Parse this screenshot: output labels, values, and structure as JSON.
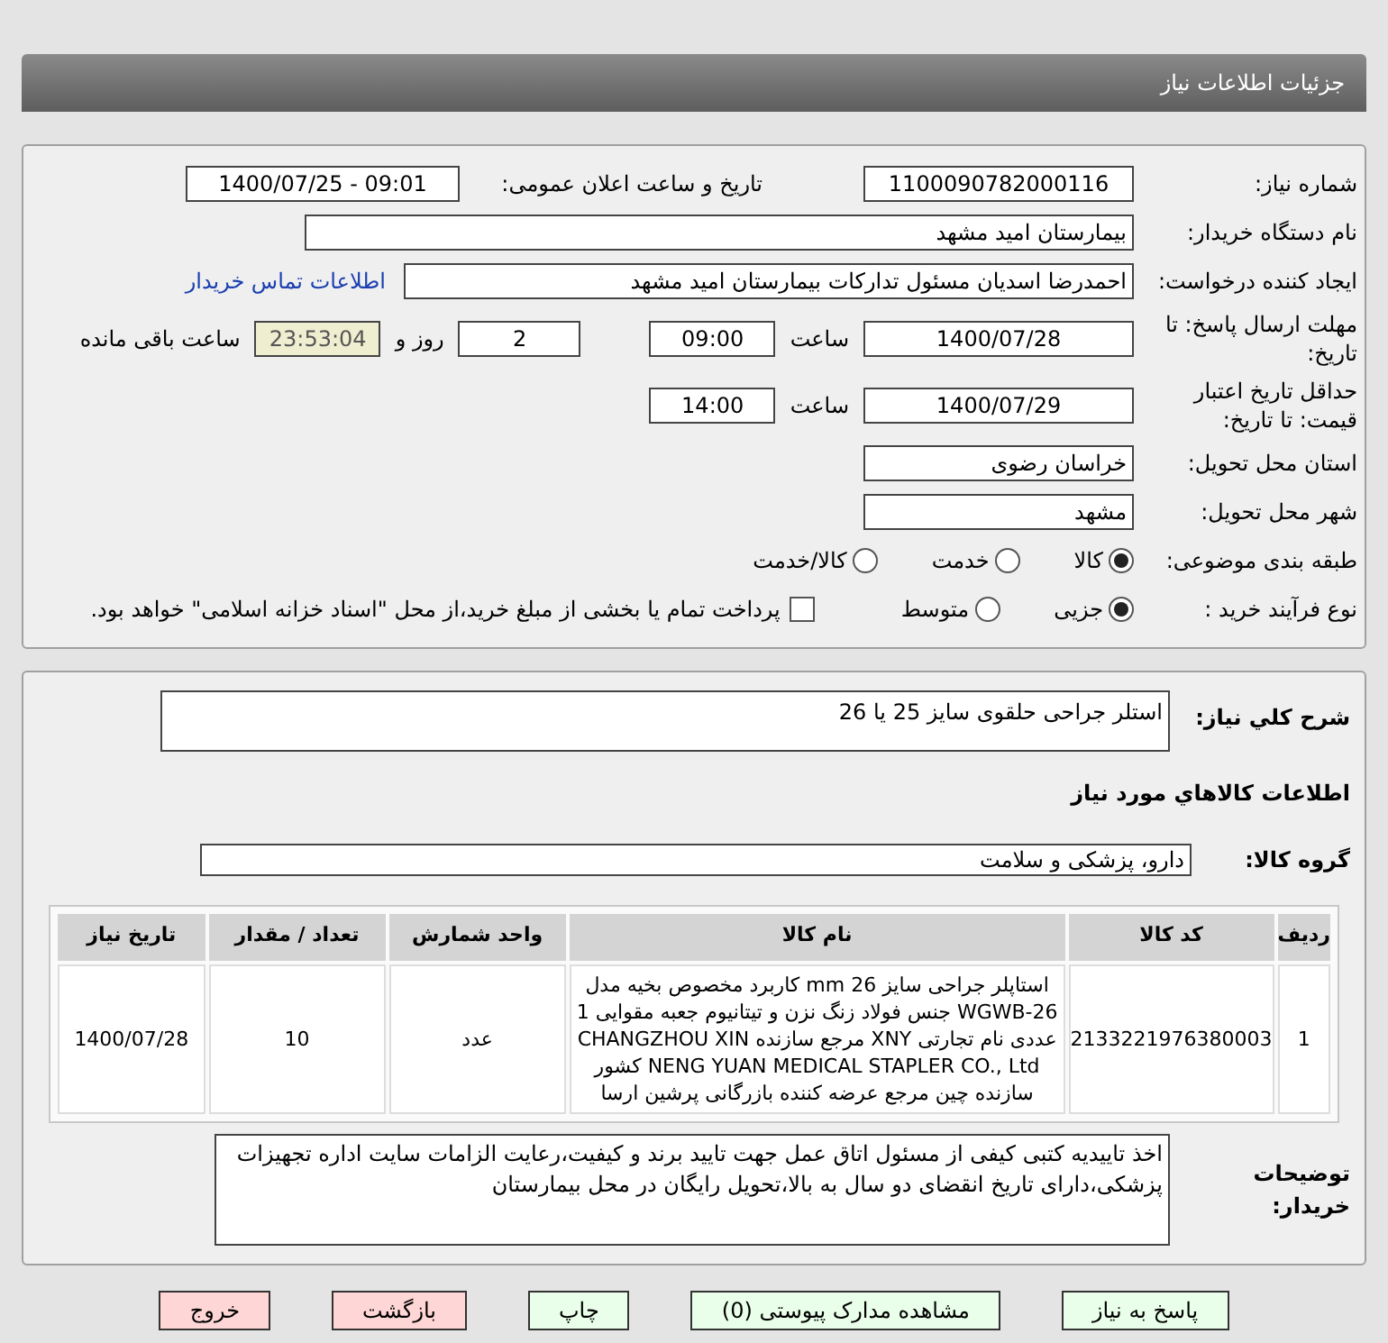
{
  "page_title": "جزئیات اطلاعات نیاز",
  "need_number": {
    "label": "شماره نیاز:",
    "value": "1100090782000116"
  },
  "announce": {
    "label": "تاریخ و ساعت اعلان عمومی:",
    "value": "1400/07/25 - 09:01"
  },
  "buyer": {
    "label": "نام دستگاه خریدار:",
    "value": "بیمارستان امید مشهد"
  },
  "requester": {
    "label": "ایجاد کننده درخواست:",
    "value": "احمدرضا اسدیان مسئول تدارکات بیمارستان امید مشهد",
    "link": "اطلاعات تماس خریدار"
  },
  "deadline": {
    "label": "مهلت ارسال پاسخ: تا تاریخ:",
    "date": "1400/07/28",
    "time_label": "ساعت",
    "time": "09:00",
    "days": "2",
    "days_label": "روز و",
    "remaining": "23:53:04",
    "remaining_label": "ساعت باقی مانده"
  },
  "validity": {
    "label": "حداقل تاریخ اعتبار قیمت: تا تاریخ:",
    "date": "1400/07/29",
    "time_label": "ساعت",
    "time": "14:00"
  },
  "province": {
    "label": "استان محل تحویل:",
    "value": "خراسان رضوی"
  },
  "city": {
    "label": "شهر محل تحویل:",
    "value": "مشهد"
  },
  "category": {
    "label": "طبقه بندی موضوعی:",
    "options": [
      {
        "label": "کالا",
        "selected": true
      },
      {
        "label": "خدمت",
        "selected": false
      },
      {
        "label": "کالا/خدمت",
        "selected": false
      }
    ]
  },
  "process": {
    "label": "نوع فرآیند خرید :",
    "options": [
      {
        "label": "جزیی",
        "selected": true
      },
      {
        "label": "متوسط",
        "selected": false
      }
    ],
    "payment": {
      "checked": false,
      "label": "پرداخت تمام یا بخشی از مبلغ خرید،از محل \"اسناد خزانه اسلامی\" خواهد بود."
    }
  },
  "summary": {
    "label": "شرح كلي نياز:",
    "value": "استلر جراحی حلقوی سایز 25 یا 26"
  },
  "goods_heading": "اطلاعات كالاهاي مورد نياز",
  "group": {
    "label": "گروه کالا:",
    "value": "دارو، پزشکی و سلامت"
  },
  "table": {
    "columns": [
      "ردیف",
      "کد کالا",
      "نام کالا",
      "واحد شمارش",
      "تعداد / مقدار",
      "تاریخ نیاز"
    ],
    "rows": [
      [
        "1",
        "2133221976380003",
        "استاپلر جراحی سایز 26 mm کاربرد مخصوص بخیه مدل WGWB-26 جنس فولاد زنگ نزن و تیتانیوم جعبه مقوایی 1 عددی نام تجارتی XNY مرجع سازنده CHANGZHOU XIN NENG YUAN MEDICAL STAPLER CO., Ltd کشور سازنده چین مرجع عرضه کننده بازرگانی پرشین ارسا",
        "عدد",
        "10",
        "1400/07/28"
      ]
    ]
  },
  "notes": {
    "label": "توضیحات خریدار:",
    "value": "اخذ تاییدیه کتبی کیفی از مسئول اتاق عمل جهت تایید برند و کیفیت،رعایت الزامات سایت اداره تجهیزات پزشکی،دارای تاریخ انقضای دو سال به بالا،تحویل رایگان در محل بیمارستان"
  },
  "buttons": [
    {
      "label": "پاسخ به نیاز",
      "kind": "normal"
    },
    {
      "label": "مشاهده مدارک پیوستی (0)",
      "kind": "normal"
    },
    {
      "label": "چاپ",
      "kind": "normal"
    },
    {
      "label": "بازگشت",
      "kind": "danger"
    },
    {
      "label": "خروج",
      "kind": "danger"
    }
  ]
}
